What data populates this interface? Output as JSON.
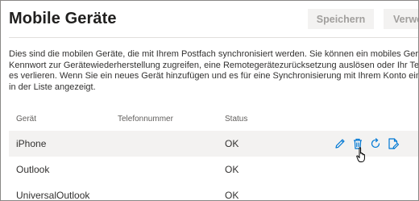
{
  "header": {
    "title": "Mobile Geräte",
    "save_label": "Speichern",
    "discard_label": "Verwe"
  },
  "description": {
    "lines": [
      "Dies sind die mobilen Geräte, die mit Ihrem Postfach synchronisiert werden. Sie können ein mobiles Gerät entfern",
      "Kennwort zur Gerätewiederherstellung zugreifen, eine Remotegerätezurücksetzung auslösen oder Ihr Telefon spe",
      "es verlieren. Wenn Sie ein neues Gerät hinzufügen und es für eine Synchronisierung mit Ihrem Konto einrichten, w",
      "in der Liste angezeigt."
    ]
  },
  "table": {
    "columns": [
      "Gerät",
      "Telefonnummer",
      "Status"
    ],
    "rows": [
      {
        "device": "iPhone",
        "phone": "",
        "status": "OK"
      },
      {
        "device": "Outlook",
        "phone": "",
        "status": "OK"
      },
      {
        "device": "UniversalOutlook",
        "phone": "",
        "status": "OK"
      }
    ]
  },
  "row_actions": {
    "icons": [
      "edit-icon",
      "delete-icon",
      "refresh-icon",
      "details-icon"
    ],
    "accent_color": "#0078d4"
  },
  "colors": {
    "hover_row": "#f3f2f1",
    "disabled_button_bg": "#f3f2f1",
    "disabled_button_text": "#a19f9d"
  }
}
